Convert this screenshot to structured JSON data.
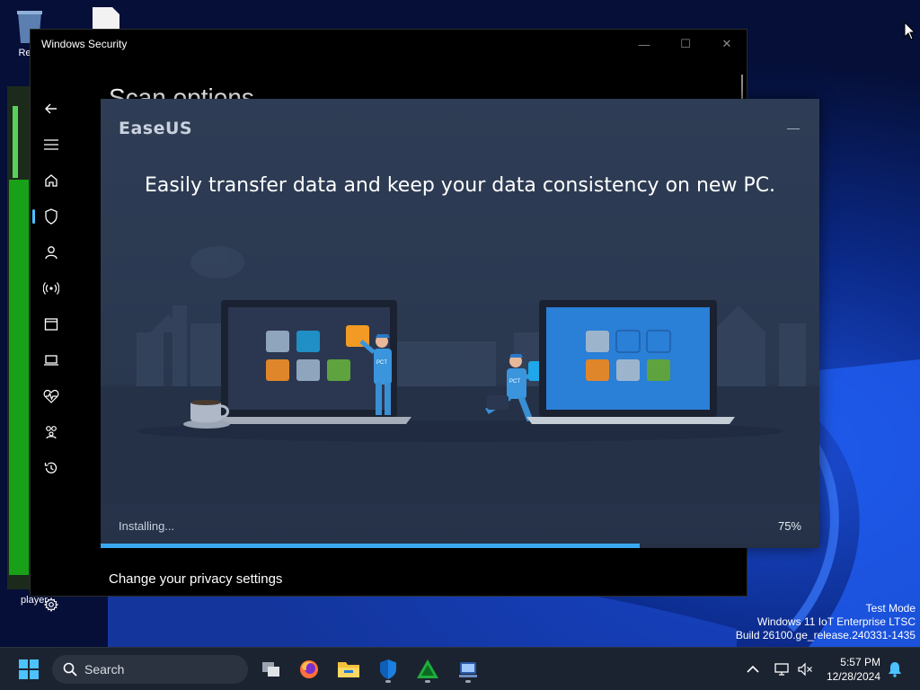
{
  "desktop": {
    "icons": [
      {
        "label": "Recy",
        "icon": "recycle-bin-icon"
      },
      {
        "label": "",
        "icon": "file-icon"
      },
      {
        "label": "player",
        "icon": "media-player-icon"
      }
    ],
    "watermark": {
      "line1": "Test Mode",
      "line2": "Windows 11 IoT Enterprise LTSC",
      "line3": "Build 26100.ge_release.240331-1435"
    }
  },
  "windows_security": {
    "title": "Windows Security",
    "heading": "Scan options",
    "privacy_link": "Change your privacy settings",
    "controls": {
      "minimize": "—",
      "maximize": "☐",
      "close": "✕"
    },
    "nav": [
      {
        "icon": "back-arrow-icon"
      },
      {
        "icon": "hamburger-menu-icon"
      },
      {
        "icon": "home-icon"
      },
      {
        "icon": "shield-icon",
        "active": true
      },
      {
        "icon": "account-protection-icon"
      },
      {
        "icon": "firewall-network-icon"
      },
      {
        "icon": "app-browser-control-icon"
      },
      {
        "icon": "device-security-icon"
      },
      {
        "icon": "device-health-icon"
      },
      {
        "icon": "family-options-icon"
      },
      {
        "icon": "protection-history-icon"
      },
      {
        "icon": "settings-gear-icon"
      }
    ]
  },
  "easeus": {
    "logo": "EaseUS",
    "minimize": "—",
    "headline": "Easily transfer data and keep your data consistency on new PC.",
    "status": "Installing...",
    "percent_label": "75%",
    "progress": 0.75,
    "accent": "#3aa8ef",
    "figure_label": "PCT"
  },
  "taskbar": {
    "search_placeholder": "Search",
    "time": "5:57 PM",
    "date": "12/28/2024",
    "apps": [
      {
        "icon": "start-windows-icon"
      },
      {
        "icon": "task-view-icon"
      },
      {
        "icon": "firefox-icon"
      },
      {
        "icon": "file-explorer-icon"
      },
      {
        "icon": "windows-security-icon",
        "running": true
      },
      {
        "icon": "green-triangle-app-icon",
        "running": true
      },
      {
        "icon": "easeus-installer-icon",
        "running": true
      }
    ],
    "tray": [
      {
        "icon": "chevron-up-icon"
      },
      {
        "icon": "network-icon"
      },
      {
        "icon": "volume-muted-icon"
      },
      {
        "icon": "notification-bell-icon"
      }
    ]
  }
}
